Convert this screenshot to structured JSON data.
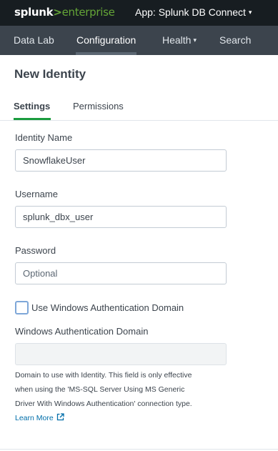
{
  "header": {
    "logo": {
      "brand": "splunk",
      "separator": ">",
      "product": "enterprise"
    },
    "app_menu_label": "App: Splunk DB Connect",
    "app_menu_caret": "▾"
  },
  "nav": {
    "items": [
      {
        "label": "Data Lab",
        "active": false,
        "has_menu": false
      },
      {
        "label": "Configuration",
        "active": true,
        "has_menu": false
      },
      {
        "label": "Health",
        "active": false,
        "has_menu": true
      },
      {
        "label": "Search",
        "active": false,
        "has_menu": false
      }
    ],
    "menu_caret": "▾"
  },
  "page": {
    "title": "New Identity"
  },
  "tabs": [
    {
      "label": "Settings",
      "active": true
    },
    {
      "label": "Permissions",
      "active": false
    }
  ],
  "form": {
    "identity_name": {
      "label": "Identity Name",
      "value": "SnowflakeUser"
    },
    "username": {
      "label": "Username",
      "value": "splunk_dbx_user"
    },
    "password": {
      "label": "Password",
      "value": "",
      "placeholder": "Optional"
    },
    "use_windows_auth": {
      "label": "Use Windows Authentication Domain",
      "checked": false
    },
    "windows_auth_domain": {
      "label": "Windows Authentication Domain",
      "value": "",
      "disabled": true
    },
    "help": {
      "lines": [
        "Domain to use with Identity. This field is only effective",
        "when using the 'MS-SQL Server Using MS Generic",
        "Driver With Windows Authentication' connection type."
      ],
      "link_label": "Learn More",
      "link_icon": "external-link-icon"
    }
  },
  "colors": {
    "top_bar": "#171d21",
    "nav_bar": "#3c444d",
    "brand_green": "#65a637",
    "tab_accent": "#1a9c3e",
    "link": "#006eaa",
    "checkbox_border": "#7ea7d8"
  }
}
